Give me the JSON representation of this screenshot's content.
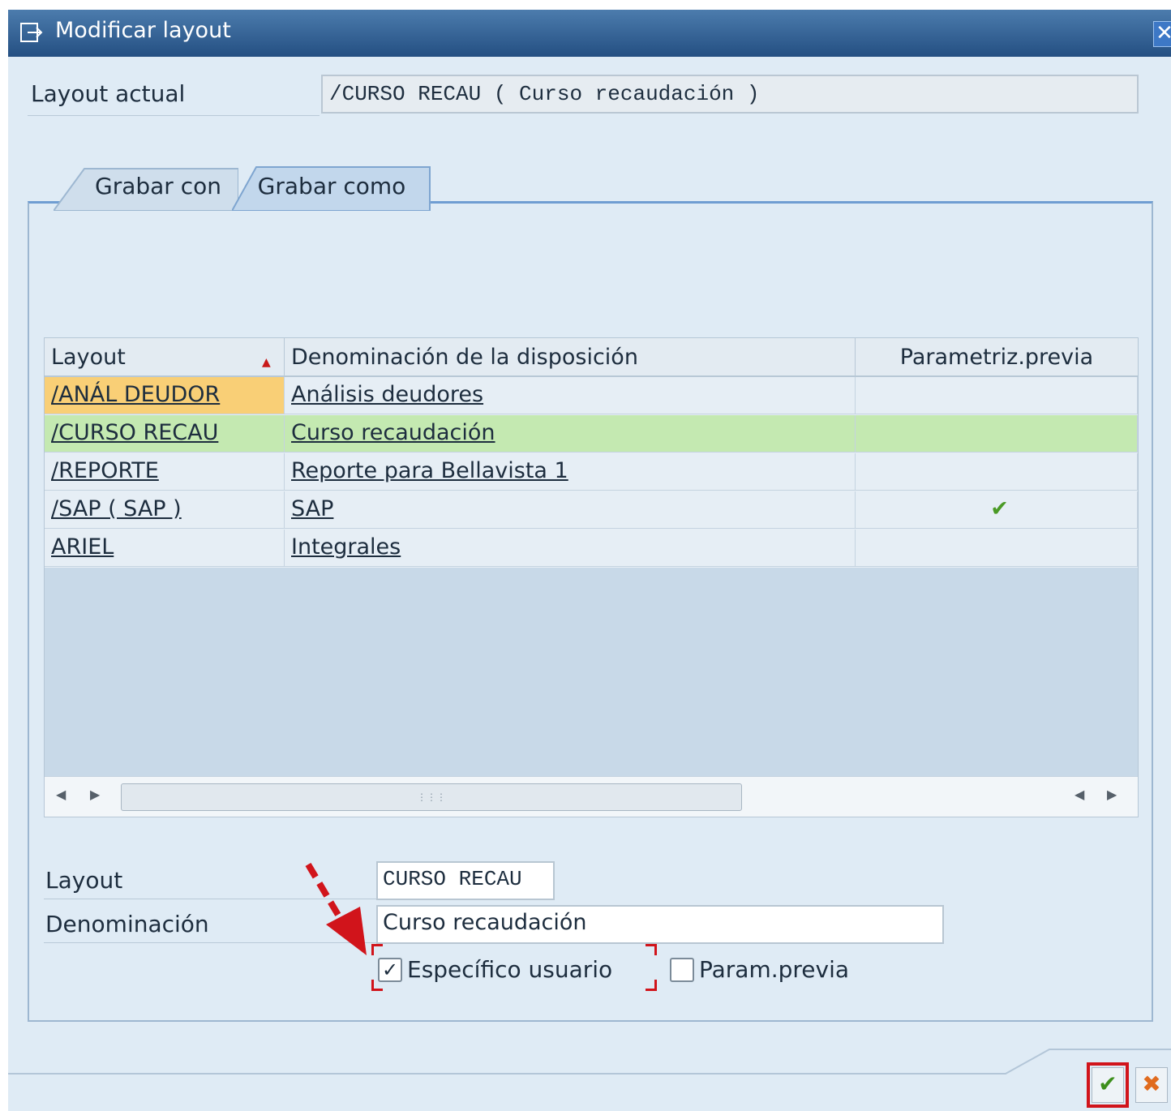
{
  "window": {
    "title": "Modificar layout",
    "close_glyph": "✕"
  },
  "current_layout": {
    "label": "Layout actual",
    "value": "/CURSO RECAU ( Curso recaudación )"
  },
  "tabs": [
    {
      "label": "Grabar con",
      "selected": false
    },
    {
      "label": "Grabar como",
      "selected": true
    }
  ],
  "grid": {
    "columns": [
      "Layout",
      "Denominación de la disposición",
      "Parametriz.previa"
    ],
    "sort_icon": "▲",
    "rows": [
      {
        "layout": "/ANÁL DEUDOR",
        "description": "Análisis deudores",
        "default": "",
        "highlight": "#f9cf76"
      },
      {
        "layout": "/CURSO RECAU",
        "description": "Curso recaudación",
        "default": "",
        "highlight": "#c4e9b1"
      },
      {
        "layout": "/REPORTE",
        "description": "Reporte para Bellavista 1",
        "default": "",
        "highlight": ""
      },
      {
        "layout": "/SAP ( SAP )",
        "description": "SAP",
        "default": "✔",
        "highlight": ""
      },
      {
        "layout": "ARIEL",
        "description": "Integrales",
        "default": "",
        "highlight": ""
      }
    ],
    "scroll_left": "◀",
    "scroll_right": "▶",
    "scroll_grip": "⋮⋮⋮"
  },
  "form": {
    "layout_label": "Layout",
    "layout_value": "CURSO RECAU",
    "description_label": "Denominación",
    "description_value": "Curso recaudación",
    "user_specific_label": "Específico usuario",
    "user_specific_checked": true,
    "default_setting_label": "Param.previa",
    "default_setting_checked": false,
    "check_glyph": "✓"
  },
  "buttons": {
    "ok_glyph": "✔",
    "cancel_glyph": "✖"
  },
  "colors": {
    "accent_red": "#d1141b",
    "title_blue": "#244f82",
    "ok_green": "#3d8f1c",
    "cancel_orange": "#e06b1e"
  }
}
